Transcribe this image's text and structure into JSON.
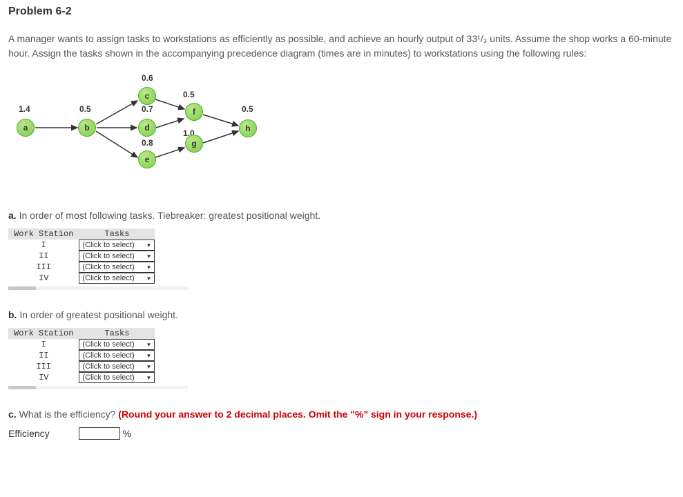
{
  "title": "Problem 6-2",
  "intro": "A manager wants to assign tasks to workstations as efficiently as possible, and achieve an hourly output of 33¹/₃ units. Assume the shop works a 60-minute hour. Assign the tasks shown in the accompanying precedence diagram (times are in minutes) to workstations using the following rules:",
  "diagram": {
    "nodes": {
      "a": {
        "label": "a",
        "time": "1.4"
      },
      "b": {
        "label": "b",
        "time": "0.5"
      },
      "c": {
        "label": "c",
        "time": "0.6"
      },
      "d": {
        "label": "d",
        "time": "0.7"
      },
      "e": {
        "label": "e",
        "time": "0.8"
      },
      "f": {
        "label": "f",
        "time": "0.5"
      },
      "g": {
        "label": "g",
        "time": "1.0"
      },
      "h": {
        "label": "h",
        "time": "0.5"
      }
    }
  },
  "part_a": {
    "label": "a.",
    "text": "In order of most following tasks. Tiebreaker: greatest positional weight.",
    "table": {
      "headers": [
        "Work Station",
        "Tasks"
      ],
      "rows": [
        {
          "station": "I",
          "select": "(Click to select)"
        },
        {
          "station": "II",
          "select": "(Click to select)"
        },
        {
          "station": "III",
          "select": "(Click to select)"
        },
        {
          "station": "IV",
          "select": "(Click to select)"
        }
      ]
    }
  },
  "part_b": {
    "label": "b.",
    "text": "In order of greatest positional weight.",
    "table": {
      "headers": [
        "Work Station",
        "Tasks"
      ],
      "rows": [
        {
          "station": "I",
          "select": "(Click to select)"
        },
        {
          "station": "II",
          "select": "(Click to select)"
        },
        {
          "station": "III",
          "select": "(Click to select)"
        },
        {
          "station": "IV",
          "select": "(Click to select)"
        }
      ]
    }
  },
  "part_c": {
    "label": "c.",
    "text": "What is the efficiency?",
    "hint": "(Round your answer to 2 decimal places. Omit the \"%\" sign in your response.)",
    "efficiency_label": "Efficiency",
    "unit": "%"
  }
}
